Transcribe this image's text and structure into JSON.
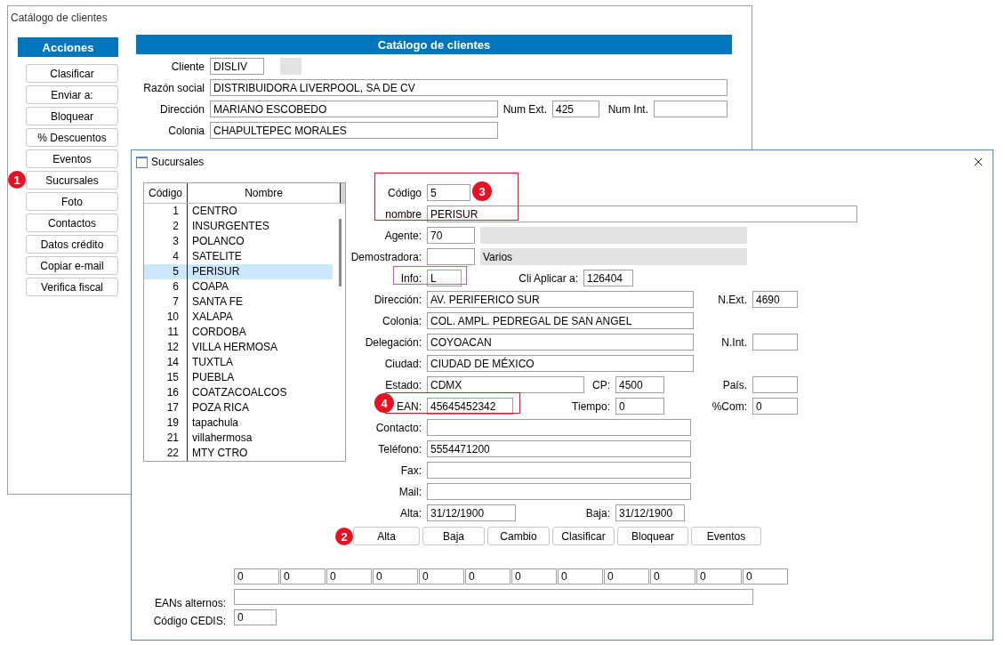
{
  "main_window": {
    "title": "Catálogo de clientes",
    "actions_header": "Acciones",
    "actions": [
      {
        "label": "Clasificar"
      },
      {
        "label": "Enviar a:"
      },
      {
        "label": "Bloquear"
      },
      {
        "label": "% Descuentos"
      },
      {
        "label": "Eventos"
      },
      {
        "label": "Sucursales",
        "badge": "1"
      },
      {
        "label": "Foto"
      },
      {
        "label": "Contactos"
      },
      {
        "label": "Datos crédito"
      },
      {
        "label": "Copiar e-mail"
      },
      {
        "label": "Verifica fiscal"
      }
    ],
    "panel_title": "Catálogo de clientes",
    "rows": [
      {
        "items": [
          {
            "kind": "field",
            "label": "Cliente",
            "value": "DISLIV"
          },
          {
            "kind": "display"
          }
        ]
      },
      {
        "items": [
          {
            "kind": "field",
            "label": "Razón social",
            "value": "DISTRIBUIDORA LIVERPOOL, SA DE CV"
          }
        ]
      },
      {
        "items": [
          {
            "kind": "field",
            "label": "Dirección",
            "value": "MARIANO ESCOBEDO"
          },
          {
            "kind": "field",
            "label": "Num Ext.",
            "value": "425"
          },
          {
            "kind": "field",
            "label": "Num Int."
          }
        ]
      },
      {
        "items": [
          {
            "kind": "field",
            "label": "Colonia",
            "value": "CHAPULTEPEC MORALES"
          }
        ]
      }
    ]
  },
  "dialog": {
    "title": "Sucursales",
    "list": {
      "columns": [
        "Código",
        "Nombre"
      ],
      "rows": [
        {
          "code": "1",
          "name": "CENTRO",
          "selected": false
        },
        {
          "code": "2",
          "name": "INSURGENTES",
          "selected": false
        },
        {
          "code": "3",
          "name": "POLANCO",
          "selected": false
        },
        {
          "code": "4",
          "name": "SATELITE",
          "selected": false
        },
        {
          "code": "5",
          "name": "PERISUR",
          "selected": true
        },
        {
          "code": "6",
          "name": "COAPA",
          "selected": false
        },
        {
          "code": "7",
          "name": "SANTA FE",
          "selected": false
        },
        {
          "code": "10",
          "name": "XALAPA",
          "selected": false
        },
        {
          "code": "11",
          "name": "CORDOBA",
          "selected": false
        },
        {
          "code": "12",
          "name": "VILLA HERMOSA",
          "selected": false
        },
        {
          "code": "14",
          "name": "TUXTLA",
          "selected": false
        },
        {
          "code": "15",
          "name": "PUEBLA",
          "selected": false
        },
        {
          "code": "16",
          "name": "COATZACOALCOS",
          "selected": false
        },
        {
          "code": "17",
          "name": "POZA RICA",
          "selected": false
        },
        {
          "code": "19",
          "name": "tapachula",
          "selected": false
        },
        {
          "code": "21",
          "name": "villahermosa",
          "selected": false
        },
        {
          "code": "22",
          "name": "MTY CTRO",
          "selected": false
        }
      ]
    },
    "form": [
      {
        "items": [
          {
            "kind": "field",
            "label": "Código",
            "value": "5"
          }
        ]
      },
      {
        "items": [
          {
            "kind": "field",
            "label": "nombre",
            "value": "PERISUR"
          }
        ]
      },
      {
        "items": [
          {
            "kind": "field",
            "label": "Agente:",
            "value": "70"
          },
          {
            "kind": "display"
          }
        ]
      },
      {
        "items": [
          {
            "kind": "field",
            "label": "Demostradora:"
          },
          {
            "kind": "display",
            "value": "Varios"
          }
        ]
      },
      {
        "items": [
          {
            "kind": "field",
            "label": "Info:",
            "value": "L"
          },
          {
            "kind": "field",
            "label": "Cli Aplicar a:",
            "value": "126404"
          }
        ]
      },
      {
        "items": [
          {
            "kind": "field",
            "label": "Dirección:",
            "value": "AV. PERIFERICO SUR"
          },
          {
            "kind": "field",
            "label": "N.Ext.",
            "value": "4690"
          }
        ]
      },
      {
        "items": [
          {
            "kind": "field",
            "label": "Colonia:",
            "value": "COL. AMPL. PEDREGAL DE SAN ANGEL"
          }
        ]
      },
      {
        "items": [
          {
            "kind": "field",
            "label": "Delegación:",
            "value": "COYOACAN"
          },
          {
            "kind": "field",
            "label": "N.Int."
          }
        ]
      },
      {
        "items": [
          {
            "kind": "field",
            "label": "Ciudad:",
            "value": "CIUDAD DE MÉXICO"
          }
        ]
      },
      {
        "items": [
          {
            "kind": "field",
            "label": "Estado:",
            "value": "CDMX"
          },
          {
            "kind": "field",
            "label": "CP:",
            "value": "4500"
          },
          {
            "kind": "field",
            "label": "País."
          }
        ]
      },
      {
        "items": [
          {
            "kind": "field",
            "label": "EAN:",
            "value": "45645452342"
          },
          {
            "kind": "field",
            "label": "Tiempo:",
            "value": "0"
          },
          {
            "kind": "field",
            "label": "%Com:",
            "value": "0"
          }
        ]
      },
      {
        "items": [
          {
            "kind": "field",
            "label": "Contacto:"
          }
        ]
      },
      {
        "items": [
          {
            "kind": "field",
            "label": "Teléfono:",
            "value": "5554471200"
          }
        ]
      },
      {
        "items": [
          {
            "kind": "field",
            "label": "Fax:"
          }
        ]
      },
      {
        "items": [
          {
            "kind": "field",
            "label": "Mail:"
          }
        ]
      },
      {
        "items": [
          {
            "kind": "field",
            "label": "Alta:",
            "value": "31/12/1900"
          },
          {
            "kind": "field",
            "label": "Baja:",
            "value": "31/12/1900"
          }
        ]
      }
    ],
    "buttons": [
      {
        "label": "Alta",
        "badge": "2"
      },
      {
        "label": "Baja"
      },
      {
        "label": "Cambio"
      },
      {
        "label": "Clasificar"
      },
      {
        "label": "Bloquear"
      },
      {
        "label": "Eventos"
      }
    ],
    "ean_boxes": [
      "0",
      "0",
      "0",
      "0",
      "0",
      "0",
      "0",
      "0",
      "0",
      "0",
      "0",
      "0"
    ],
    "eans_label": "EANs alternos:",
    "cedis": {
      "label": "Código CEDIS:",
      "value": "0"
    },
    "annotations": [
      {
        "kind": "box",
        "color": "#e81123",
        "badge": "3"
      },
      {
        "kind": "box",
        "color": "#e040e0"
      },
      {
        "kind": "box",
        "color": "#e81123",
        "badge": "4"
      }
    ]
  }
}
